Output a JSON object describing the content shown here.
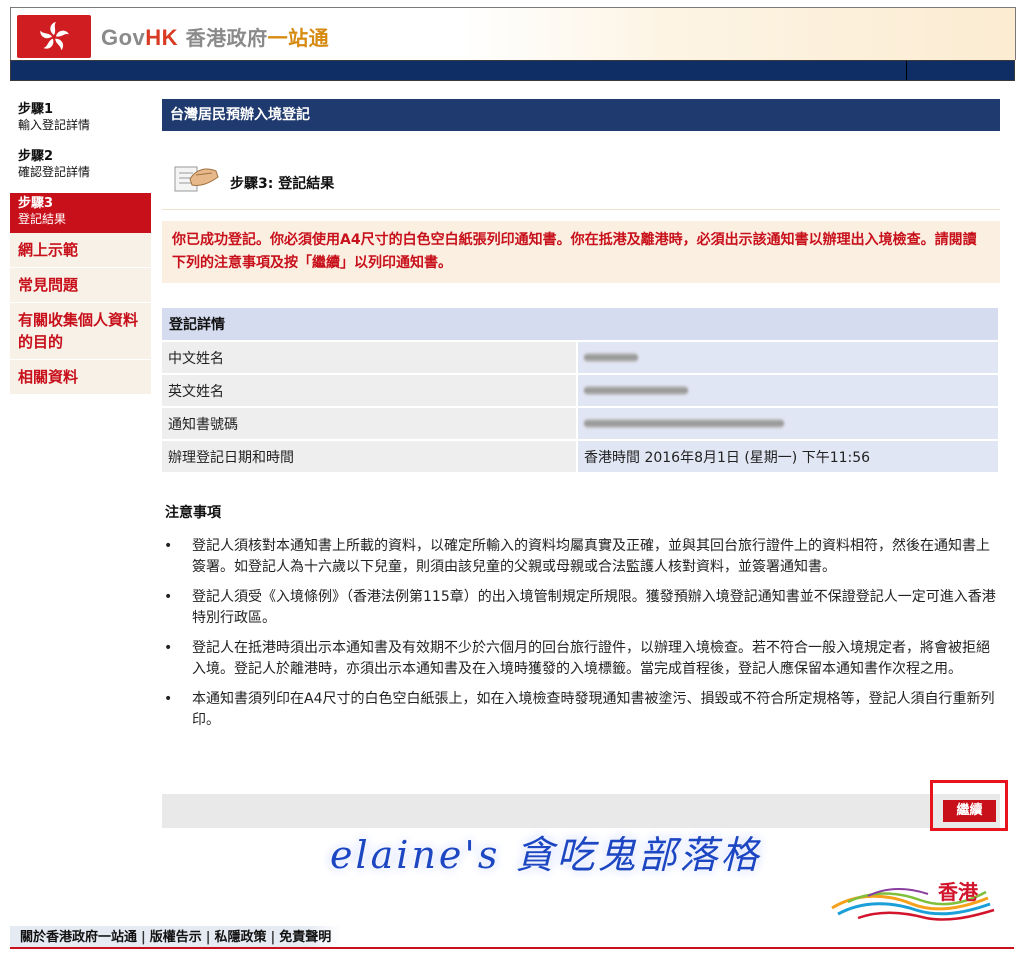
{
  "header": {
    "logo_gov": "Gov",
    "logo_hk": "HK",
    "logo_cn_part1": "香港政府",
    "logo_cn_part2": "一站通"
  },
  "sidebar": {
    "steps": [
      {
        "num": "步驟1",
        "desc": "輸入登記詳情"
      },
      {
        "num": "步驟2",
        "desc": "確認登記詳情"
      },
      {
        "num": "步驟3",
        "desc": "登記結果"
      }
    ],
    "links": [
      "網上示範",
      "常見問題",
      "有關收集個人資料的目的",
      "相關資料"
    ]
  },
  "main": {
    "title": "台灣居民預辦入境登記",
    "step_label": "步驟3: 登記結果",
    "notice": "你已成功登記。你必須使用A4尺寸的白色空白紙張列印通知書。你在抵港及離港時，必須出示該通知書以辦理出入境檢查。請閱讀下列的注意事項及按「繼續」以列印通知書。",
    "details": {
      "heading": "登記詳情",
      "rows": [
        {
          "label": "中文姓名",
          "value": ""
        },
        {
          "label": "英文姓名",
          "value": ""
        },
        {
          "label": "通知書號碼",
          "value": ""
        },
        {
          "label": "辦理登記日期和時間",
          "value": "香港時間 2016年8月1日 (星期一) 下午11:56"
        }
      ]
    },
    "notes_heading": "注意事項",
    "notes": [
      "登記人須核對本通知書上所載的資料，以確定所輸入的資料均屬真實及正確，並與其回台旅行證件上的資料相符，然後在通知書上簽署。如登記人為十六歲以下兒童，則須由該兒童的父親或母親或合法監護人核對資料，並簽署通知書。",
      "登記人須受《入境條例》（香港法例第115章）的出入境管制規定所規限。獲發預辦入境登記通知書並不保證登記人一定可進入香港特別行政區。",
      "登記人在抵港時須出示本通知書及有效期不少於六個月的回台旅行證件，以辦理入境檢查。若不符合一般入境規定者，將會被拒絕入境。登記人於離港時，亦須出示本通知書及在入境時獲發的入境標籤。當完成首程後，登記人應保留本通知書作次程之用。",
      "本通知書須列印在A4尺寸的白色空白紙張上，如在入境檢查時發現通知書被塗污、損毀或不符合所定規格等，登記人須自行重新列印。"
    ],
    "continue_label": "繼續"
  },
  "watermark": "elaine's 貪吃鬼部落格",
  "brand_text": "香港",
  "footer": {
    "links": [
      "關於香港政府一站通",
      "版權告示",
      "私隱政策",
      "免責聲明"
    ]
  },
  "colors": {
    "accent_red": "#c8101b",
    "navy": "#1f3a6e",
    "detail_header": "#d5dcef"
  }
}
